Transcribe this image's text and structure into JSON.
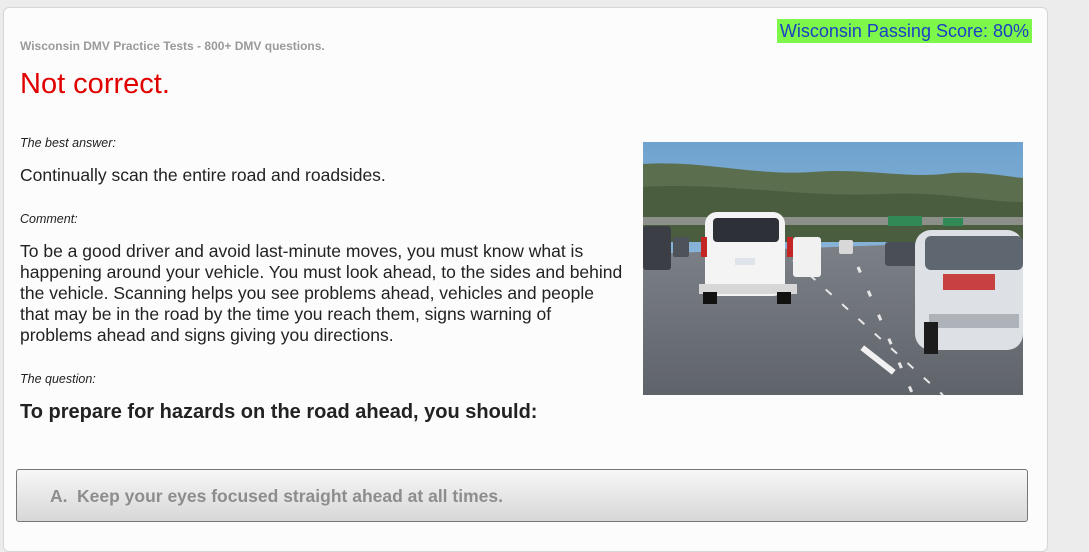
{
  "header": {
    "passing_score": "Wisconsin Passing Score: 80%",
    "site_title": "Wisconsin DMV Practice Tests - 800+ DMV questions."
  },
  "result": {
    "status": "Not correct."
  },
  "feedback": {
    "best_answer_label": "The best answer:",
    "best_answer": "Continually scan the entire road and roadsides.",
    "comment_label": "Comment:",
    "comment": "To be a good driver and avoid last-minute moves, you must know what is happening around your vehicle. You must look ahead, to the sides and behind the vehicle. Scanning helps you see problems ahead, vehicles and people that may be in the road by the time you reach them, signs warning of problems ahead and signs giving you directions."
  },
  "question": {
    "label": "The question:",
    "text": "To prepare for hazards on the road ahead, you should:"
  },
  "answers": [
    {
      "letter": "A.",
      "text": "Keep your eyes focused straight ahead at all times."
    }
  ],
  "colors": {
    "error": "#e00000",
    "badge_bg": "#7df74a",
    "badge_text": "#1c3fc4"
  }
}
